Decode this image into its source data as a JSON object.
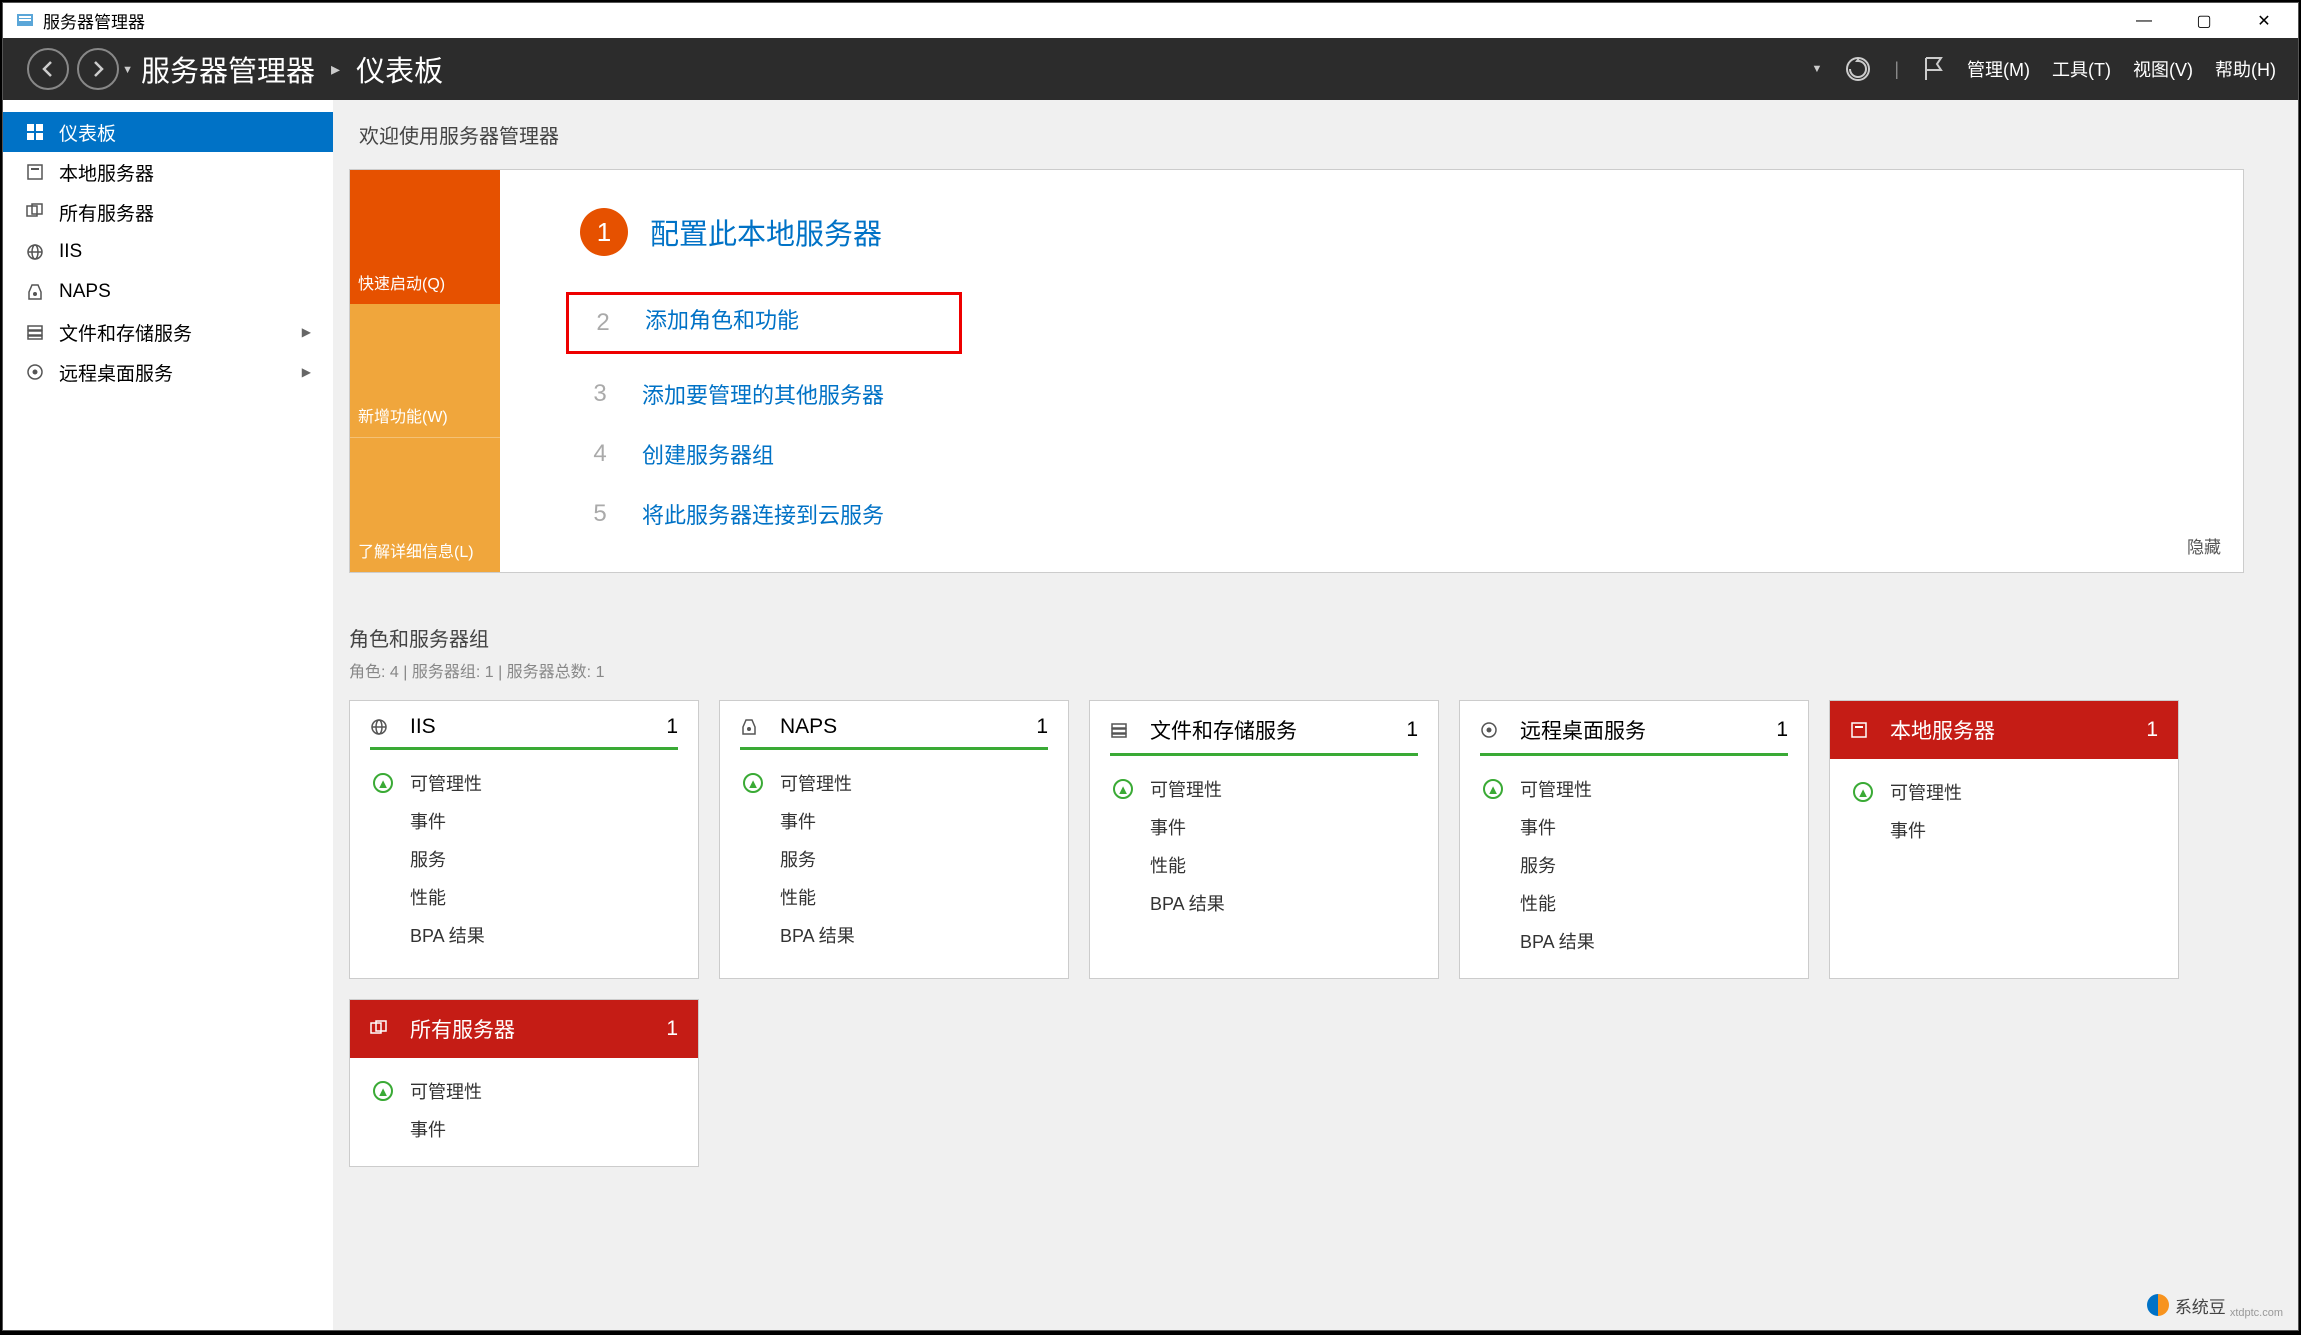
{
  "titlebar": {
    "title": "服务器管理器"
  },
  "toolbar": {
    "breadcrumb": [
      "服务器管理器",
      "仪表板"
    ],
    "menus": {
      "manage": "管理(M)",
      "tools": "工具(T)",
      "view": "视图(V)",
      "help": "帮助(H)"
    }
  },
  "sidebar": {
    "items": [
      {
        "label": "仪表板",
        "icon": "dashboard",
        "selected": true
      },
      {
        "label": "本地服务器",
        "icon": "local-server"
      },
      {
        "label": "所有服务器",
        "icon": "all-servers"
      },
      {
        "label": "IIS",
        "icon": "iis"
      },
      {
        "label": "NAPS",
        "icon": "naps"
      },
      {
        "label": "文件和存储服务",
        "icon": "file-storage",
        "expand": true
      },
      {
        "label": "远程桌面服务",
        "icon": "remote-desktop",
        "expand": true
      }
    ]
  },
  "welcome": {
    "title": "欢迎使用服务器管理器",
    "tabs": {
      "quick": "快速启动(Q)",
      "whatsnew": "新增功能(W)",
      "learn": "了解详细信息(L)"
    },
    "steps": [
      {
        "num": "1",
        "label": "配置此本地服务器",
        "primary": true
      },
      {
        "num": "2",
        "label": "添加角色和功能",
        "highlight": true
      },
      {
        "num": "3",
        "label": "添加要管理的其他服务器"
      },
      {
        "num": "4",
        "label": "创建服务器组"
      },
      {
        "num": "5",
        "label": "将此服务器连接到云服务"
      }
    ],
    "hide": "隐藏"
  },
  "roles": {
    "title": "角色和服务器组",
    "subtitle": "角色: 4 | 服务器组: 1 | 服务器总数: 1",
    "rowLabels": {
      "manage": "可管理性",
      "events": "事件",
      "services": "服务",
      "perf": "性能",
      "bpa": "BPA 结果"
    },
    "tiles": [
      {
        "title": "IIS",
        "count": "1",
        "icon": "iis",
        "header": "green",
        "rows": [
          "manage",
          "events",
          "services",
          "perf",
          "bpa"
        ]
      },
      {
        "title": "NAPS",
        "count": "1",
        "icon": "naps",
        "header": "green",
        "rows": [
          "manage",
          "events",
          "services",
          "perf",
          "bpa"
        ]
      },
      {
        "title": "文件和存储服务",
        "count": "1",
        "icon": "file-storage",
        "header": "green",
        "rows": [
          "manage",
          "events",
          "perf",
          "bpa"
        ]
      },
      {
        "title": "远程桌面服务",
        "count": "1",
        "icon": "remote-desktop",
        "header": "green",
        "rows": [
          "manage",
          "events",
          "services",
          "perf",
          "bpa"
        ]
      },
      {
        "title": "本地服务器",
        "count": "1",
        "icon": "local-server",
        "header": "red",
        "rows": [
          "manage",
          "events"
        ]
      },
      {
        "title": "所有服务器",
        "count": "1",
        "icon": "all-servers",
        "header": "red",
        "rows": [
          "manage",
          "events"
        ]
      }
    ]
  },
  "watermark": {
    "text": "系统豆",
    "sub": "xtdptc.com"
  }
}
